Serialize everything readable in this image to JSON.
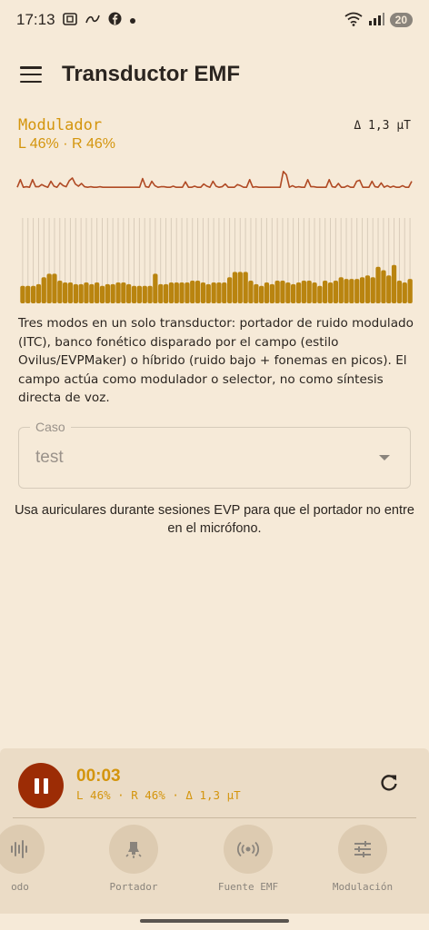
{
  "status_bar": {
    "time": "17:13",
    "left_icons": [
      "screenshot-icon",
      "link-icon",
      "facebook-icon",
      "dot-icon"
    ],
    "right_icons": [
      "wifi-icon",
      "signal-icon"
    ],
    "battery": "20"
  },
  "app_bar": {
    "title": "Transductor EMF",
    "menu_icon": "menu-icon"
  },
  "modulator": {
    "label": "Modulador",
    "delta": "Δ 1,3 µT",
    "lr": "L 46% · R 46%"
  },
  "chart_data": {
    "type": "bar",
    "wave_values": [
      0.15,
      0.85,
      0.15,
      0.2,
      0.15,
      0.85,
      0.2,
      0.2,
      0.4,
      0.25,
      0.15,
      0.7,
      0.25,
      0.15,
      0.55,
      0.3,
      0.2,
      0.75,
      1.0,
      0.45,
      0.25,
      0.5,
      0.2,
      0.15,
      0.2,
      0.15,
      0.15,
      0.2,
      0.15,
      0.15,
      0.15,
      0.15,
      0.15,
      0.15,
      0.15,
      0.15,
      0.15,
      0.15,
      0.15,
      0.15,
      0.15,
      0.95,
      0.2,
      0.15,
      0.7,
      0.3,
      0.15,
      0.2,
      0.2,
      0.15,
      0.15,
      0.25,
      0.15,
      0.15,
      0.15,
      0.65,
      0.15,
      0.15,
      0.25,
      0.15,
      0.15,
      0.45,
      0.25,
      0.15,
      0.7,
      0.25,
      0.15,
      0.2,
      0.45,
      0.15,
      0.15,
      0.15,
      0.4,
      0.3,
      0.15,
      0.15,
      0.85,
      0.15,
      0.2,
      0.15,
      0.15,
      0.15,
      0.15,
      0.15,
      0.15,
      0.15,
      0.15,
      1.6,
      1.3,
      0.15,
      0.3,
      0.15,
      0.2,
      0.15,
      0.15,
      0.85,
      0.2,
      0.2,
      0.15,
      0.15,
      0.15,
      0.15,
      0.85,
      0.2,
      0.15,
      0.5,
      0.15,
      0.15,
      0.3,
      0.15,
      0.15,
      0.7,
      0.8,
      0.15,
      0.15,
      0.15,
      0.7,
      0.2,
      0.15,
      0.55,
      0.15,
      0.3,
      0.15,
      0.25,
      0.15,
      0.15,
      0.3,
      0.15,
      0.15,
      0.7
    ],
    "bar_values": [
      0.2,
      0.2,
      0.2,
      0.22,
      0.3,
      0.34,
      0.34,
      0.26,
      0.24,
      0.24,
      0.22,
      0.22,
      0.24,
      0.22,
      0.24,
      0.2,
      0.22,
      0.22,
      0.24,
      0.24,
      0.22,
      0.2,
      0.2,
      0.2,
      0.2,
      0.34,
      0.22,
      0.22,
      0.24,
      0.24,
      0.24,
      0.24,
      0.26,
      0.26,
      0.24,
      0.22,
      0.24,
      0.24,
      0.24,
      0.3,
      0.36,
      0.36,
      0.36,
      0.26,
      0.22,
      0.2,
      0.24,
      0.22,
      0.26,
      0.26,
      0.24,
      0.22,
      0.24,
      0.26,
      0.26,
      0.24,
      0.2,
      0.26,
      0.24,
      0.26,
      0.3,
      0.28,
      0.28,
      0.28,
      0.3,
      0.32,
      0.3,
      0.42,
      0.38,
      0.32,
      0.44,
      0.26,
      0.24,
      0.28
    ]
  },
  "description": "Tres modos en un solo transductor: portador de ruido modulado (ITC), banco fonético disparado por el campo (estilo Ovilus/EVPMaker) o híbrido (ruido bajo + fonemas en picos). El campo actúa como modulador o selector, no como síntesis directa de voz.",
  "case_field": {
    "label": "Caso",
    "value": "test"
  },
  "hint": "Usa auriculares durante sesiones EVP para que el portador no entre en el micrófono.",
  "player": {
    "timer": "00:03",
    "meta": "L 46% · R 46% · Δ 1,3 µT"
  },
  "modes": [
    {
      "label": "odo",
      "icon": "waveform-icon"
    },
    {
      "label": "Portador",
      "icon": "lamp-icon"
    },
    {
      "label": "Fuente EMF",
      "icon": "radio-waves-icon"
    },
    {
      "label": "Modulación",
      "icon": "sliders-icon"
    }
  ],
  "colors": {
    "background": "#f6ead8",
    "accent": "#d4950d",
    "wave": "#b04a24",
    "bar": "#b9840f",
    "pause": "#9c2c05"
  }
}
